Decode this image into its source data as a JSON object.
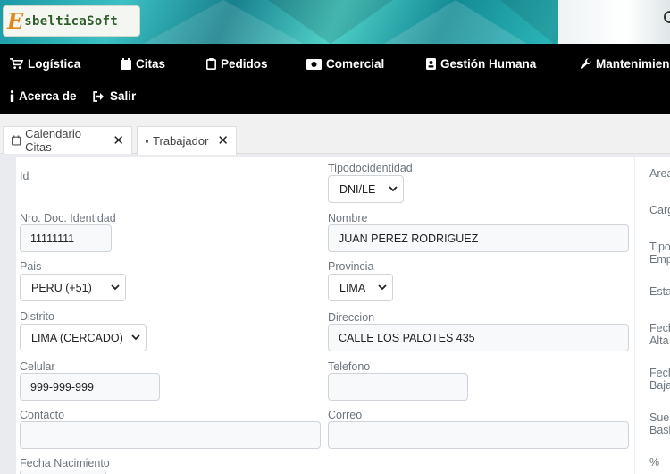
{
  "brand": {
    "logo_letter": "E",
    "logo_text": "sbelticaSoft"
  },
  "nav": {
    "items": [
      {
        "label": "Logística",
        "icon": "cart-icon"
      },
      {
        "label": "Citas",
        "icon": "calendar-icon"
      },
      {
        "label": "Pedidos",
        "icon": "clipboard-icon"
      },
      {
        "label": "Comercial",
        "icon": "money-icon"
      },
      {
        "label": "Gestión Humana",
        "icon": "id-badge-icon"
      },
      {
        "label": "Mantenimien",
        "icon": "wrench-icon"
      },
      {
        "label": "Acerca de",
        "icon": "info-icon"
      },
      {
        "label": "Salir",
        "icon": "sign-out-icon"
      }
    ]
  },
  "tabs": [
    {
      "label": "Calendario Citas",
      "icon": "calendar-icon",
      "close": "✕"
    },
    {
      "label": "Trabajador",
      "icon": "id-badge-icon",
      "close": "✕"
    }
  ],
  "form": {
    "id_label": "Id",
    "tipodoc_label": "Tipodocidentidad",
    "tipodoc_value": "DNI/LE",
    "nrodoc_label": "Nro. Doc. Identidad",
    "nrodoc_value": "11111111",
    "nombre_label": "Nombre",
    "nombre_value": "JUAN PEREZ RODRIGUEZ",
    "pais_label": "Pais",
    "pais_value": "PERU (+51)",
    "provincia_label": "Provincia",
    "provincia_value": "LIMA",
    "distrito_label": "Distrito",
    "distrito_value": "LIMA (CERCADO)",
    "direccion_label": "Direccion",
    "direccion_value": "CALLE LOS PALOTES 435",
    "celular_label": "Celular",
    "celular_value": "999-999-999",
    "telefono_label": "Telefono",
    "telefono_value": "",
    "contacto_label": "Contacto",
    "contacto_value": "",
    "correo_label": "Correo",
    "correo_value": "",
    "fechanac_label": "Fecha Nacimiento"
  },
  "side": {
    "area": "Area",
    "cargo": "Carg",
    "tipo": "Tipo\nEmp",
    "estado": "Esta",
    "fecha_alta": "Fech\nAlta",
    "fecha_baja": "Fech\nBaja",
    "sueldo": "Suel\nBasi",
    "pct": "%"
  }
}
